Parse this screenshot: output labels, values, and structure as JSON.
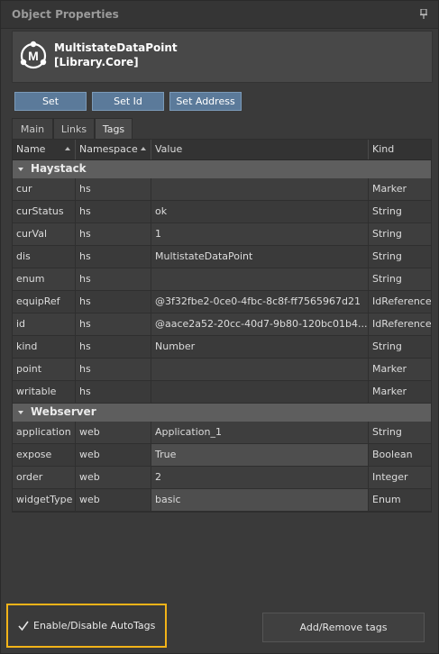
{
  "panel": {
    "title": "Object Properties",
    "pin_icon": "pin-icon"
  },
  "object": {
    "name": "MultistateDataPoint",
    "library": "[Library.Core]",
    "icon": "module-logo-icon",
    "logo_letter": "M"
  },
  "actions": {
    "set": "Set",
    "set_id": "Set Id",
    "set_address": "Set Address"
  },
  "tabs": [
    {
      "label": "Main",
      "active": false
    },
    {
      "label": "Links",
      "active": false
    },
    {
      "label": "Tags",
      "active": true
    }
  ],
  "columns": {
    "name": "Name",
    "namespace": "Namespace",
    "value": "Value",
    "kind": "Kind"
  },
  "groups": [
    {
      "label": "Haystack",
      "rows": [
        {
          "name": "cur",
          "namespace": "hs",
          "value": "",
          "kind": "Marker"
        },
        {
          "name": "curStatus",
          "namespace": "hs",
          "value": "ok",
          "kind": "String"
        },
        {
          "name": "curVal",
          "namespace": "hs",
          "value": "1",
          "kind": "String"
        },
        {
          "name": "dis",
          "namespace": "hs",
          "value": "MultistateDataPoint",
          "kind": "String"
        },
        {
          "name": "enum",
          "namespace": "hs",
          "value": "",
          "kind": "String"
        },
        {
          "name": "equipRef",
          "namespace": "hs",
          "value": "@3f32fbe2-0ce0-4fbc-8c8f-ff7565967d21",
          "kind": "IdReference"
        },
        {
          "name": "id",
          "namespace": "hs",
          "value": "@aace2a52-20cc-40d7-9b80-120bc01b4...",
          "kind": "IdReference"
        },
        {
          "name": "kind",
          "namespace": "hs",
          "value": "Number",
          "kind": "String"
        },
        {
          "name": "point",
          "namespace": "hs",
          "value": "",
          "kind": "Marker"
        },
        {
          "name": "writable",
          "namespace": "hs",
          "value": "",
          "kind": "Marker"
        }
      ]
    },
    {
      "label": "Webserver",
      "rows": [
        {
          "name": "application",
          "namespace": "web",
          "value": "Application_1",
          "kind": "String",
          "editable": false
        },
        {
          "name": "expose",
          "namespace": "web",
          "value": "True",
          "kind": "Boolean",
          "editable": true
        },
        {
          "name": "order",
          "namespace": "web",
          "value": "2",
          "kind": "Integer",
          "editable": false
        },
        {
          "name": "widgetType",
          "namespace": "web",
          "value": "basic",
          "kind": "Enum",
          "editable": true
        }
      ]
    }
  ],
  "footer": {
    "autotags_label": "Enable/Disable AutoTags",
    "autotags_checked": true,
    "add_remove": "Add/Remove tags"
  },
  "colors": {
    "highlight": "#f2b318",
    "button": "#5b7a9a"
  }
}
